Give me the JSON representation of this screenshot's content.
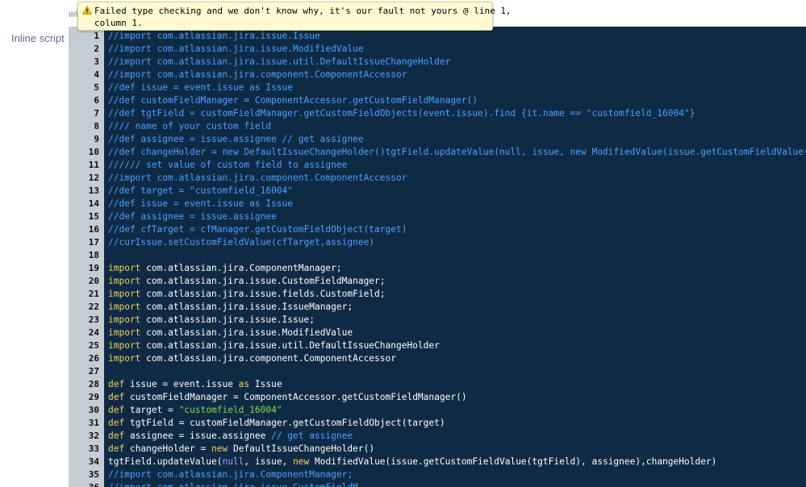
{
  "top_fragment": "wi",
  "field_label": "Inline script",
  "tooltip": {
    "line1": "Failed type checking and we don't know why, it's our fault not yours @ line 1,",
    "line2": "column 1."
  },
  "editor": {
    "lines": [
      {
        "n": "1",
        "tokens": [
          {
            "t": "//import com.atlassian.jira.issue.Issue",
            "c": "comment"
          }
        ]
      },
      {
        "n": "2",
        "tokens": [
          {
            "t": "//import com.atlassian.jira.issue.ModifiedValue",
            "c": "comment"
          }
        ]
      },
      {
        "n": "3",
        "tokens": [
          {
            "t": "//import com.atlassian.jira.issue.util.DefaultIssueChangeHolder",
            "c": "comment"
          }
        ]
      },
      {
        "n": "4",
        "tokens": [
          {
            "t": "//import com.atlassian.jira.component.ComponentAccessor",
            "c": "comment"
          }
        ]
      },
      {
        "n": "5",
        "tokens": [
          {
            "t": "//def issue = event.issue as Issue",
            "c": "comment"
          }
        ]
      },
      {
        "n": "6",
        "tokens": [
          {
            "t": "//def customFieldManager = ComponentAccessor.getCustomFieldManager()",
            "c": "comment"
          }
        ]
      },
      {
        "n": "7",
        "tokens": [
          {
            "t": "//def tgtField = customFieldManager.getCustomFieldObjects(event.issue).find {it.name == \"customfield_16004\"}",
            "c": "comment"
          }
        ]
      },
      {
        "n": "8",
        "tokens": [
          {
            "t": "//// name of your custom field",
            "c": "comment"
          }
        ]
      },
      {
        "n": "9",
        "tokens": [
          {
            "t": "//def assignee = issue.assignee // get assignee",
            "c": "comment"
          }
        ]
      },
      {
        "n": "10",
        "tokens": [
          {
            "t": "//def changeHolder = new DefaultIssueChangeHolder()tgtField.updateValue(null, issue, new ModifiedValue(issue.getCustomFieldValue(tgtField), assignee),changeHolder)",
            "c": "comment"
          }
        ]
      },
      {
        "n": "11",
        "tokens": [
          {
            "t": "////// set value of custom field to assignee",
            "c": "comment"
          }
        ]
      },
      {
        "n": "12",
        "tokens": [
          {
            "t": "//import com.atlassian.jira.component.ComponentAccessor",
            "c": "comment"
          }
        ]
      },
      {
        "n": "13",
        "tokens": [
          {
            "t": "//def target = \"customfield_16004\"",
            "c": "comment"
          }
        ]
      },
      {
        "n": "14",
        "tokens": [
          {
            "t": "//def issue = event.issue as Issue",
            "c": "comment"
          }
        ]
      },
      {
        "n": "15",
        "tokens": [
          {
            "t": "//def assignee = issue.assignee",
            "c": "comment"
          }
        ]
      },
      {
        "n": "16",
        "tokens": [
          {
            "t": "//def cfTarget = cfManager.getCustomFieldObject(target)",
            "c": "comment"
          }
        ]
      },
      {
        "n": "17",
        "tokens": [
          {
            "t": "//curIssue.setCustomFieldValue(cfTarget,assignee)",
            "c": "comment"
          }
        ]
      },
      {
        "n": "18",
        "tokens": []
      },
      {
        "n": "19",
        "tokens": [
          {
            "t": "import",
            "c": "kw"
          },
          {
            "t": " com.atlassian.jira.ComponentManager;",
            "c": "plain"
          }
        ]
      },
      {
        "n": "20",
        "tokens": [
          {
            "t": "import",
            "c": "kw"
          },
          {
            "t": " com.atlassian.jira.issue.CustomFieldManager;",
            "c": "plain"
          }
        ]
      },
      {
        "n": "21",
        "tokens": [
          {
            "t": "import",
            "c": "kw"
          },
          {
            "t": " com.atlassian.jira.issue.fields.CustomField;",
            "c": "plain"
          }
        ]
      },
      {
        "n": "22",
        "tokens": [
          {
            "t": "import",
            "c": "kw"
          },
          {
            "t": " com.atlassian.jira.issue.IssueManager;",
            "c": "plain"
          }
        ]
      },
      {
        "n": "23",
        "tokens": [
          {
            "t": "import",
            "c": "kw"
          },
          {
            "t": " com.atlassian.jira.issue.Issue;",
            "c": "plain"
          }
        ]
      },
      {
        "n": "24",
        "tokens": [
          {
            "t": "import",
            "c": "kw"
          },
          {
            "t": " com.atlassian.jira.issue.ModifiedValue",
            "c": "plain"
          }
        ]
      },
      {
        "n": "25",
        "tokens": [
          {
            "t": "import",
            "c": "kw"
          },
          {
            "t": " com.atlassian.jira.issue.util.DefaultIssueChangeHolder",
            "c": "plain"
          }
        ]
      },
      {
        "n": "26",
        "tokens": [
          {
            "t": "import",
            "c": "kw"
          },
          {
            "t": " com.atlassian.jira.component.ComponentAccessor",
            "c": "plain"
          }
        ]
      },
      {
        "n": "27",
        "tokens": []
      },
      {
        "n": "28",
        "tokens": [
          {
            "t": "def",
            "c": "kw"
          },
          {
            "t": " issue = event.issue ",
            "c": "plain"
          },
          {
            "t": "as",
            "c": "kw"
          },
          {
            "t": " Issue",
            "c": "plain"
          }
        ]
      },
      {
        "n": "29",
        "tokens": [
          {
            "t": "def",
            "c": "kw"
          },
          {
            "t": " customFieldManager = ComponentAccessor.getCustomFieldManager()",
            "c": "plain"
          }
        ]
      },
      {
        "n": "30",
        "tokens": [
          {
            "t": "def",
            "c": "kw"
          },
          {
            "t": " target = ",
            "c": "plain"
          },
          {
            "t": "\"customfield_16004\"",
            "c": "str"
          }
        ]
      },
      {
        "n": "31",
        "tokens": [
          {
            "t": "def",
            "c": "kw"
          },
          {
            "t": " tgtField = customFieldManager.getCustomFieldObject(target)",
            "c": "plain"
          }
        ]
      },
      {
        "n": "32",
        "tokens": [
          {
            "t": "def",
            "c": "kw"
          },
          {
            "t": " assignee = issue.assignee ",
            "c": "plain"
          },
          {
            "t": "// get assignee",
            "c": "comment"
          }
        ]
      },
      {
        "n": "33",
        "tokens": [
          {
            "t": "def",
            "c": "kw"
          },
          {
            "t": " changeHolder = ",
            "c": "plain"
          },
          {
            "t": "new",
            "c": "kw"
          },
          {
            "t": " DefaultIssueChangeHolder()",
            "c": "plain"
          }
        ]
      },
      {
        "n": "34",
        "tokens": [
          {
            "t": "tgtField.updateValue(",
            "c": "plain"
          },
          {
            "t": "null",
            "c": "null"
          },
          {
            "t": ", issue, ",
            "c": "plain"
          },
          {
            "t": "new",
            "c": "kw"
          },
          {
            "t": " ModifiedValue(issue.getCustomFieldValue(tgtField), assignee),changeHolder)",
            "c": "plain"
          }
        ]
      },
      {
        "n": "35",
        "tokens": [
          {
            "t": "//import com.atlassian.jira.ComponentManager;",
            "c": "comment"
          }
        ]
      },
      {
        "n": "36",
        "tokens": [
          {
            "t": "//import com.atlassian.jira.issue.CustomFieldM",
            "c": "comment"
          }
        ]
      }
    ]
  },
  "colors": {
    "editor_bg": "#0e2a47",
    "gutter_bg": "#c6ccd3",
    "comment": "#4aa3ff",
    "keyword": "#f4d35e",
    "string": "#7ee04a",
    "null": "#b89cff",
    "tooltip_bg": "#fffad2"
  },
  "icons": {
    "gutter_warning": "warning-icon",
    "tooltip_warning": "warning-icon"
  }
}
